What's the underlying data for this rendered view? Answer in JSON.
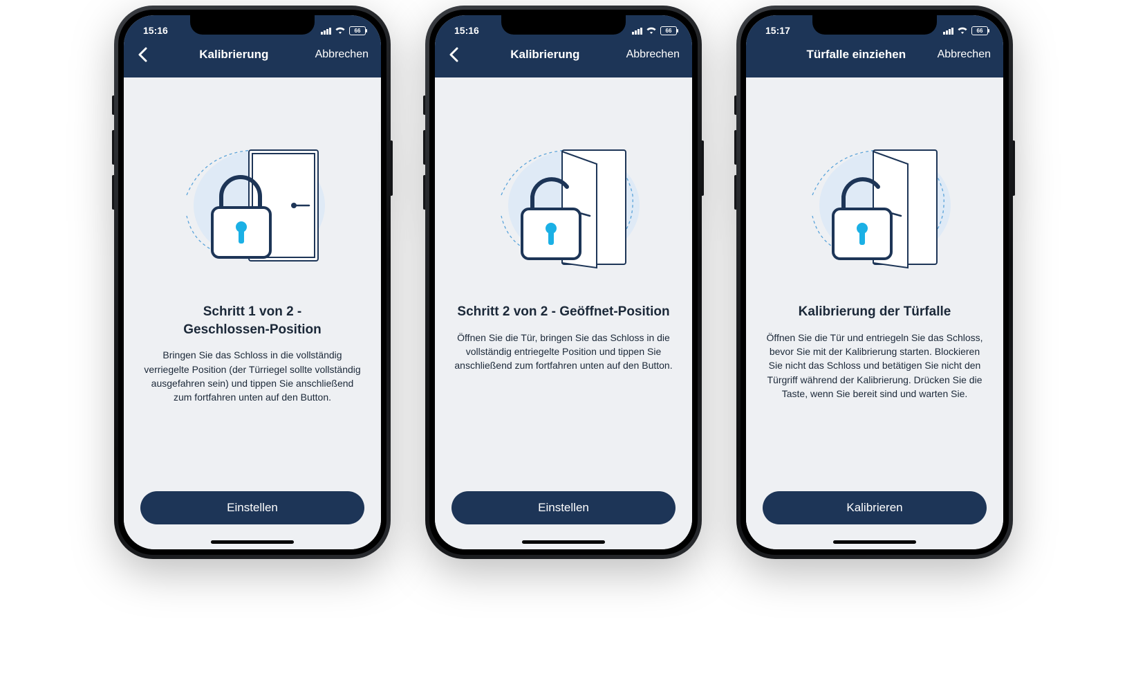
{
  "phones": [
    {
      "status": {
        "time": "15:16",
        "battery": "66"
      },
      "nav": {
        "show_back": true,
        "title": "Kalibrierung",
        "cancel": "Abbrechen"
      },
      "illustration": "locked-door",
      "heading": "Schritt 1 von 2 -\nGeschlossen-Position",
      "body": "Bringen Sie das Schloss in die vollständig verriegelte Position (der Türriegel sollte vollständig ausgefahren sein) und tippen Sie anschließend zum fortfahren unten auf den Button.",
      "button": "Einstellen"
    },
    {
      "status": {
        "time": "15:16",
        "battery": "66"
      },
      "nav": {
        "show_back": true,
        "title": "Kalibrierung",
        "cancel": "Abbrechen"
      },
      "illustration": "open-door",
      "heading": "Schritt 2 von 2 - Geöffnet-Position",
      "body": "Öffnen Sie die Tür, bringen Sie das Schloss in die vollständig entriegelte Position und tippen Sie anschließend zum fortfahren unten auf den Button.",
      "button": "Einstellen"
    },
    {
      "status": {
        "time": "15:17",
        "battery": "66"
      },
      "nav": {
        "show_back": false,
        "title": "Türfalle einziehen",
        "cancel": "Abbrechen"
      },
      "illustration": "open-door",
      "heading": "Kalibrierung der Türfalle",
      "body": "Öffnen Sie die Tür und entriegeln Sie das Schloss, bevor Sie mit der Kalibrierung starten. Blockieren Sie nicht das Schloss und betätigen Sie nicht den Türgriff während der Kalibrierung. Drücken Sie die Taste, wenn Sie bereit sind und warten Sie.",
      "button": "Kalibrieren"
    }
  ]
}
